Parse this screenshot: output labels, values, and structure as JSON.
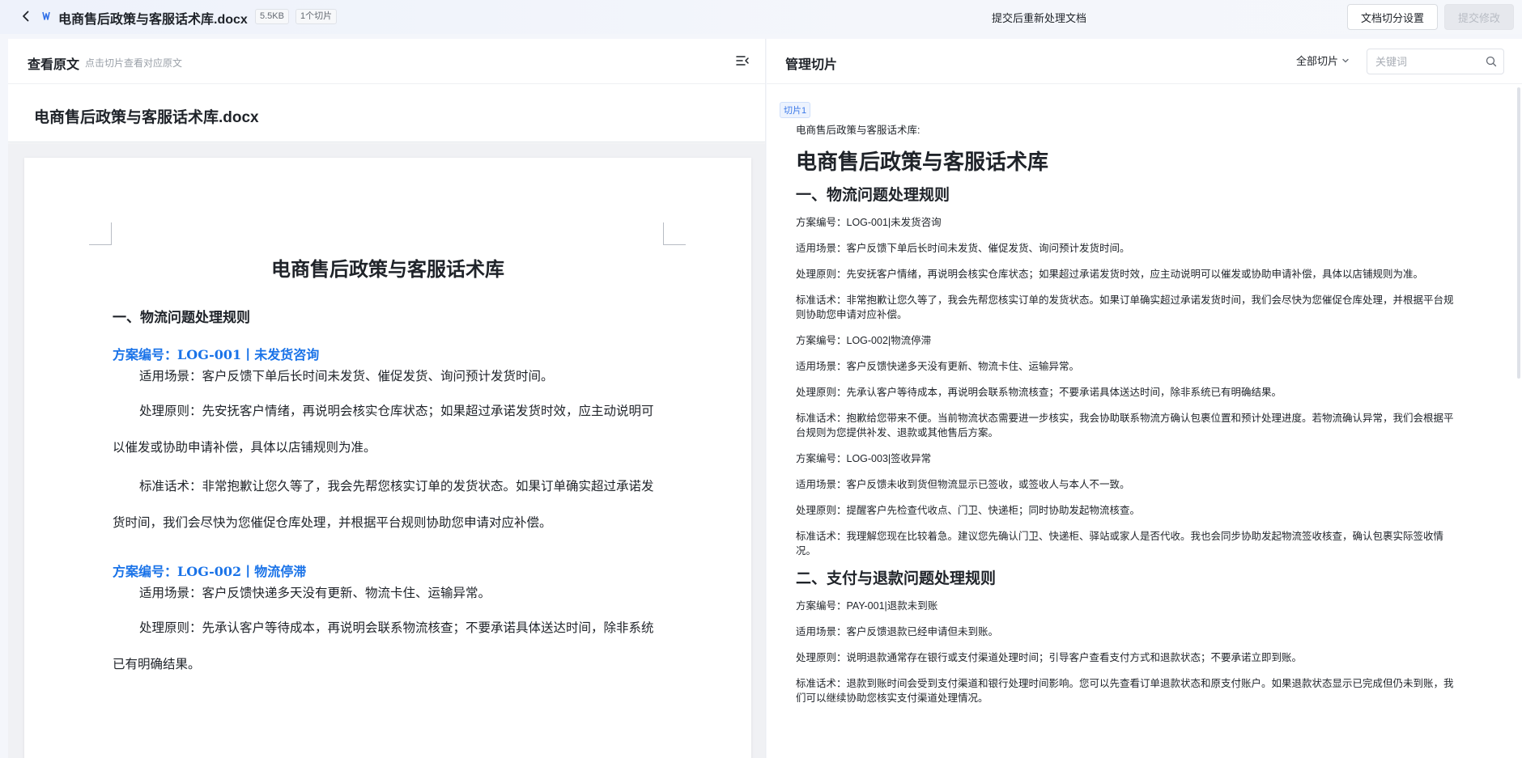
{
  "topbar": {
    "file_title": "电商售后政策与客服话术库.docx",
    "file_size": "5.5KB",
    "chunk_count": "1个切片",
    "resubmit_text": "提交后重新处理文档",
    "split_settings_label": "文档切分设置",
    "submit_label": "提交修改",
    "icons": [
      "back-icon",
      "word-file-icon"
    ]
  },
  "left": {
    "title": "查看原文",
    "hint": "点击切片查看对应原文",
    "doc_name": "电商售后政策与客服话术库.docx",
    "page": {
      "title": "电商售后政策与客服话术库",
      "section1": "一、物流问题处理规则",
      "case1_title": "方案编号：LOG-001丨未发货咨询",
      "case1_scene": "适用场景：客户反馈下单后长时间未发货、催促发货、询问预计发货时间。",
      "case1_rule": "处理原则：先安抚客户情绪，再说明会核实仓库状态；如果超过承诺发货时效，应主动说明可以催发或协助申请补偿，具体以店铺规则为准。",
      "case1_script": "标准话术：非常抱歉让您久等了，我会先帮您核实订单的发货状态。如果订单确实超过承诺发货时间，我们会尽快为您催促仓库处理，并根据平台规则协助您申请对应补偿。",
      "case2_title": "方案编号：LOG-002丨物流停滞",
      "case2_scene": "适用场景：客户反馈快递多天没有更新、物流卡住、运输异常。",
      "case2_rule": "处理原则：先承认客户等待成本，再说明会联系物流核查；不要承诺具体送达时间，除非系统已有明确结果。"
    }
  },
  "right": {
    "title": "管理切片",
    "filter_label": "全部切片",
    "search_placeholder": "关键词",
    "chunk_badge": "切片1",
    "chunk": {
      "intro": "电商售后政策与客服话术库:",
      "title": "电商售后政策与客服话术库",
      "h1": "一、物流问题处理规则",
      "l1": "方案编号：LOG-001|未发货咨询",
      "l2": "适用场景：客户反馈下单后长时间未发货、催促发货、询问预计发货时间。",
      "l3": "处理原则：先安抚客户情绪，再说明会核实仓库状态；如果超过承诺发货时效，应主动说明可以催发或协助申请补偿，具体以店铺规则为准。",
      "l4": "标准话术：非常抱歉让您久等了，我会先帮您核实订单的发货状态。如果订单确实超过承诺发货时间，我们会尽快为您催促仓库处理，并根据平台规则协助您申请对应补偿。",
      "l5": "方案编号：LOG-002|物流停滞",
      "l6": "适用场景：客户反馈快递多天没有更新、物流卡住、运输异常。",
      "l7": "处理原则：先承认客户等待成本，再说明会联系物流核查；不要承诺具体送达时间，除非系统已有明确结果。",
      "l8": "标准话术：抱歉给您带来不便。当前物流状态需要进一步核实，我会协助联系物流方确认包裹位置和预计处理进度。若物流确认异常，我们会根据平台规则为您提供补发、退款或其他售后方案。",
      "l9": "方案编号：LOG-003|签收异常",
      "l10": "适用场景：客户反馈未收到货但物流显示已签收，或签收人与本人不一致。",
      "l11": "处理原则：提醒客户先检查代收点、门卫、快递柜；同时协助发起物流核查。",
      "l12": "标准话术：我理解您现在比较着急。建议您先确认门卫、快递柜、驿站或家人是否代收。我也会同步协助发起物流签收核查，确认包裹实际签收情况。",
      "h2": "二、支付与退款问题处理规则",
      "l13": "方案编号：PAY-001|退款未到账",
      "l14": "适用场景：客户反馈退款已经申请但未到账。",
      "l15": "处理原则：说明退款通常存在银行或支付渠道处理时间；引导客户查看支付方式和退款状态；不要承诺立即到账。",
      "l16": "标准话术：退款到账时间会受到支付渠道和银行处理时间影响。您可以先查看订单退款状态和原支付账户。如果退款状态显示已完成但仍未到账，我们可以继续协助您核实支付渠道处理情况。"
    }
  },
  "colors": {
    "accent": "#1a73e8",
    "badge": "#3a78e8"
  }
}
